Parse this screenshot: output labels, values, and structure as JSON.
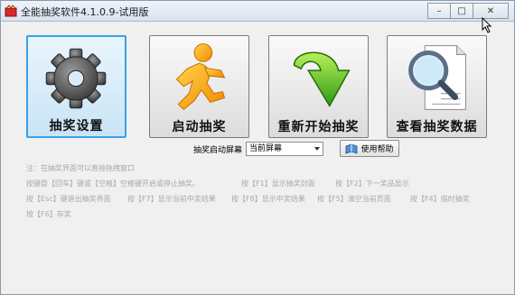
{
  "window": {
    "title": "全能抽奖软件4.1.0.9-试用版",
    "controls": {
      "minimize": "–",
      "maximize": "□",
      "close": "✕"
    }
  },
  "tiles": [
    {
      "label": "抽奖设置",
      "icon": "gear-icon",
      "selected": true
    },
    {
      "label": "启动抽奖",
      "icon": "running-man-icon",
      "selected": false
    },
    {
      "label": "重新开始抽奖",
      "icon": "green-arrow-icon",
      "selected": false
    },
    {
      "label": "查看抽奖数据",
      "icon": "magnifier-document-icon",
      "selected": false
    }
  ],
  "screen_option": {
    "label": "抽奖启动屏幕",
    "value": "当前屏幕"
  },
  "help_button": {
    "label": "使用帮助",
    "icon": "book-icon"
  },
  "notes": {
    "line1": "注：在抽奖界面可以直接拖拽窗口",
    "line2": "按键盘【回车】键或【空格】空格键开启或停止抽奖。",
    "line2_b": "按【F1】显示抽奖封面",
    "line2_c": "按【F2】下一奖品显示",
    "line3_a": "按【Esc】键退出抽奖界面",
    "line3_b": "按【F7】显示当前中奖结果",
    "line3_c": "按【F8】显示中奖结果",
    "line3_d": "按【F5】清空当前页面",
    "line3_e": "按【F4】临时抽奖",
    "line4": "按【F6】存奖"
  }
}
